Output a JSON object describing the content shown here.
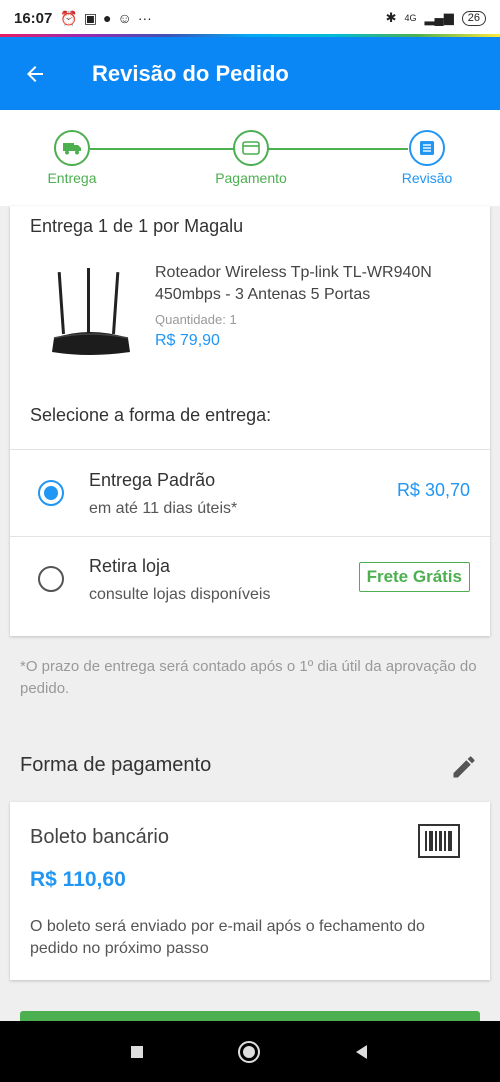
{
  "status_bar": {
    "time": "16:07",
    "network": "4G",
    "battery": "26"
  },
  "app_bar": {
    "title": "Revisão do Pedido"
  },
  "stepper": {
    "steps": [
      {
        "label": "Entrega",
        "icon": "truck-icon",
        "state": "done"
      },
      {
        "label": "Pagamento",
        "icon": "card-icon",
        "state": "done"
      },
      {
        "label": "Revisão",
        "icon": "list-icon",
        "state": "active"
      }
    ]
  },
  "delivery": {
    "header": "Entrega 1 de 1 por Magalu",
    "product": {
      "name": "Roteador Wireless Tp-link TL-WR940N 450mbps - 3 Antenas 5 Portas",
      "quantity_label": "Quantidade:",
      "quantity": "1",
      "price": "R$ 79,90"
    },
    "select_title": "Selecione a forma de entrega:",
    "options": [
      {
        "title": "Entrega Padrão",
        "subtitle": "em até 11 dias úteis*",
        "price": "R$ 30,70",
        "selected": true
      },
      {
        "title": "Retira loja",
        "subtitle": "consulte lojas disponíveis",
        "badge": "Frete Grátis",
        "selected": false
      }
    ]
  },
  "note": "*O prazo de entrega será contado após o 1º dia útil da aprovação do pedido.",
  "payment": {
    "heading": "Forma de pagamento",
    "method": "Boleto bancário",
    "total": "R$ 110,60",
    "description": "O boleto será enviado por e-mail após o fechamento do pedido no próximo passo"
  },
  "colors": {
    "primary": "#0a86f5",
    "accent_blue": "#2196f3",
    "success_green": "#4caf50"
  }
}
